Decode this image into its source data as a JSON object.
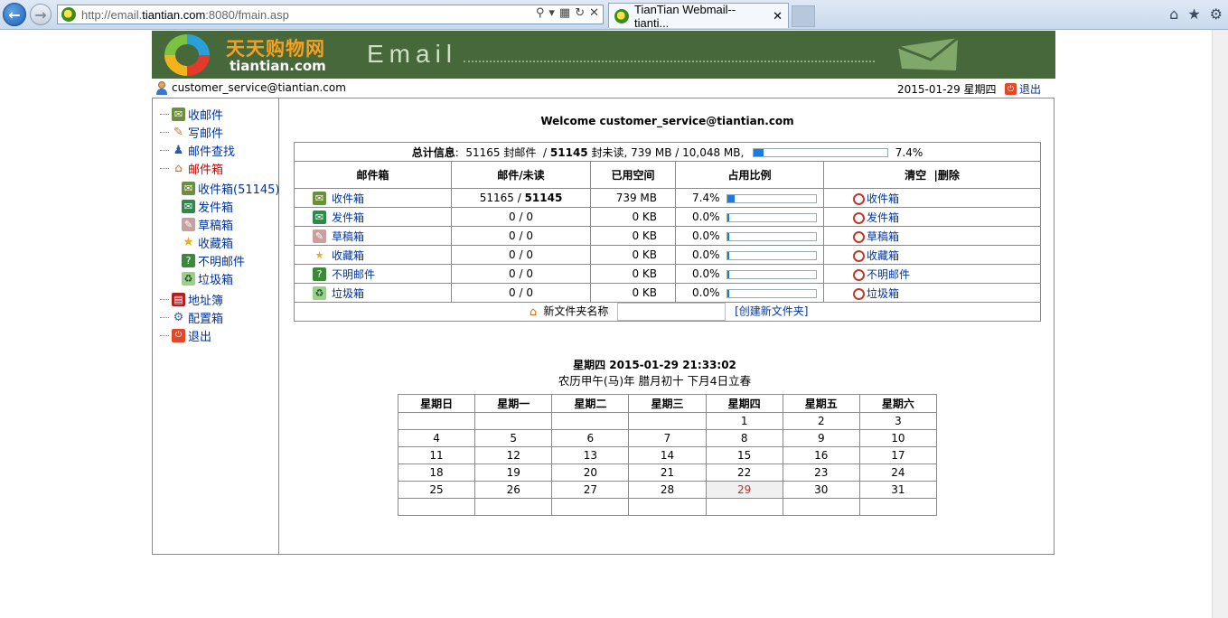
{
  "browser": {
    "url_prefix": "http://email.",
    "url_host": "tiantian.com",
    "url_suffix": ":8080/fmain.asp",
    "tab_title": "TianTian Webmail--tianti..."
  },
  "banner": {
    "logo_cn": "天天购物网",
    "logo_en": "tiantian.com",
    "title": "Email"
  },
  "userbar": {
    "email": "customer_service@tiantian.com",
    "date": "2015-01-29 星期四",
    "logout": "退出"
  },
  "sidebar": {
    "items": [
      {
        "label": "收邮件"
      },
      {
        "label": "写邮件"
      },
      {
        "label": "邮件查找"
      },
      {
        "label": "邮件箱"
      },
      {
        "label": "收件箱(51145)"
      },
      {
        "label": "发件箱"
      },
      {
        "label": "草稿箱"
      },
      {
        "label": "收藏箱"
      },
      {
        "label": "不明邮件"
      },
      {
        "label": "垃圾箱"
      },
      {
        "label": "地址簿"
      },
      {
        "label": "配置箱"
      },
      {
        "label": "退出"
      }
    ]
  },
  "main": {
    "welcome": "Welcome customer_service@tiantian.com",
    "summary": {
      "label": "总计信息",
      "total": "51165",
      "total_unit": "封邮件",
      "unread": "51145",
      "unread_unit": "封未读,",
      "usage": "739 MB / 10,048 MB,",
      "percent": "7.4%",
      "fraction": 0.074
    },
    "headers": {
      "mailbox": "邮件箱",
      "count": "邮件/未读",
      "used": "已用空间",
      "ratio": "占用比例",
      "clear": "清空",
      "delete": "|删除"
    },
    "rows": [
      {
        "name": "收件箱",
        "total": "51165",
        "unread": "51145",
        "used": "739 MB",
        "pct": "7.4%",
        "fraction": 0.074,
        "clear": "收件箱"
      },
      {
        "name": "发件箱",
        "total": "0",
        "unread": "0",
        "used": "0 KB",
        "pct": "0.0%",
        "fraction": 0.0,
        "clear": "发件箱"
      },
      {
        "name": "草稿箱",
        "total": "0",
        "unread": "0",
        "used": "0 KB",
        "pct": "0.0%",
        "fraction": 0.0,
        "clear": "草稿箱"
      },
      {
        "name": "收藏箱",
        "total": "0",
        "unread": "0",
        "used": "0 KB",
        "pct": "0.0%",
        "fraction": 0.0,
        "clear": "收藏箱"
      },
      {
        "name": "不明邮件",
        "total": "0",
        "unread": "0",
        "used": "0 KB",
        "pct": "0.0%",
        "fraction": 0.0,
        "clear": "不明邮件"
      },
      {
        "name": "垃圾箱",
        "total": "0",
        "unread": "0",
        "used": "0 KB",
        "pct": "0.0%",
        "fraction": 0.0,
        "clear": "垃圾箱"
      }
    ],
    "new_folder_label": "新文件夹名称",
    "new_folder_value": "",
    "new_folder_link": "[创建新文件夹]",
    "calendar": {
      "title": "星期四  2015-01-29 21:33:02",
      "lunar": "农历甲午(马)年  腊月初十 下月4日立春",
      "weekdays": [
        "星期日",
        "星期一",
        "星期二",
        "星期三",
        "星期四",
        "星期五",
        "星期六"
      ],
      "weeks": [
        [
          "",
          "",
          "",
          "",
          "1",
          "2",
          "3"
        ],
        [
          "4",
          "5",
          "6",
          "7",
          "8",
          "9",
          "10"
        ],
        [
          "11",
          "12",
          "13",
          "14",
          "15",
          "16",
          "17"
        ],
        [
          "18",
          "19",
          "20",
          "21",
          "22",
          "23",
          "24"
        ],
        [
          "25",
          "26",
          "27",
          "28",
          "29",
          "30",
          "31"
        ],
        [
          "",
          "",
          "",
          "",
          "",
          "",
          ""
        ]
      ],
      "today": "29"
    }
  },
  "colors": {
    "banner_bg": "#46683a",
    "link": "#003399",
    "active": "#cc0000",
    "progress": "#1a7be0",
    "today": "#e02020"
  }
}
